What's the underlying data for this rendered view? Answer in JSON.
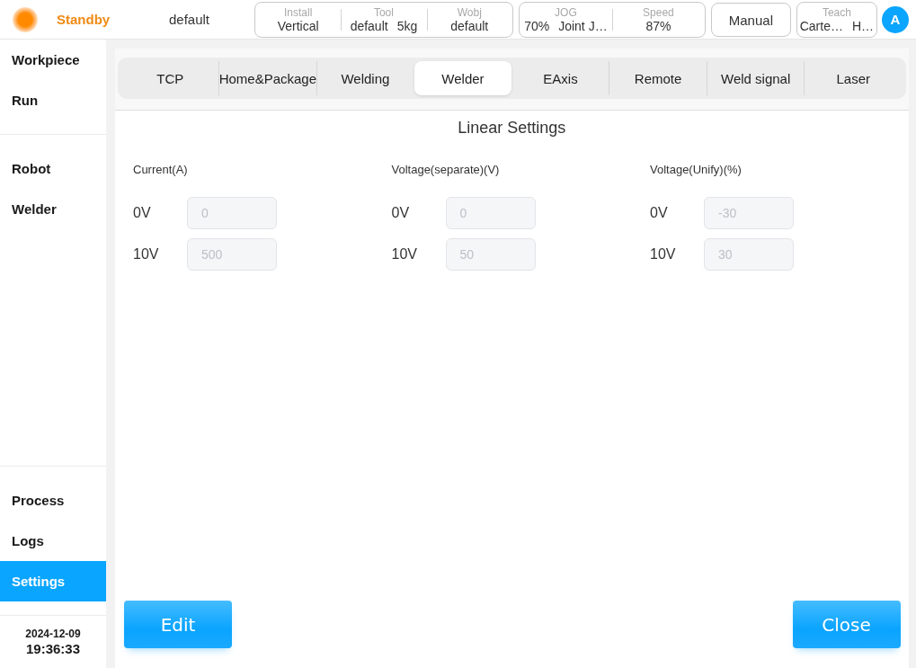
{
  "header": {
    "status": "Standby",
    "profile": "default",
    "widgets": [
      {
        "kind": "group",
        "cells": [
          {
            "label": "Install",
            "values": [
              "Vertical"
            ]
          },
          {
            "label": "Tool",
            "values": [
              "default",
              "5kg"
            ]
          },
          {
            "label": "Wobj",
            "values": [
              "default"
            ]
          }
        ]
      },
      {
        "kind": "group",
        "cells": [
          {
            "label": "JOG",
            "values": [
              "70%",
              "Joint J…"
            ]
          },
          {
            "label": "Speed",
            "values": [
              "87%"
            ]
          }
        ]
      },
      {
        "kind": "button",
        "label": "Manual"
      },
      {
        "kind": "group",
        "cells": [
          {
            "label": "Teach",
            "values": [
              "Carte…",
              "H…"
            ]
          }
        ]
      }
    ],
    "avatar": "A"
  },
  "sidebar": {
    "groups": [
      {
        "items": [
          {
            "label": "Workpiece",
            "selected": false
          },
          {
            "label": "Run",
            "selected": false
          }
        ]
      },
      {
        "items": [
          {
            "label": "Robot",
            "selected": false
          },
          {
            "label": "Welder",
            "selected": false
          }
        ]
      }
    ],
    "bottom_items": [
      {
        "label": "Process",
        "selected": false
      },
      {
        "label": "Logs",
        "selected": false
      },
      {
        "label": "Settings",
        "selected": true
      }
    ],
    "date": "2024-12-09",
    "time": "19:36:33"
  },
  "tabs": [
    {
      "label": "TCP",
      "selected": false
    },
    {
      "label": "Home&Package",
      "selected": false
    },
    {
      "label": "Welding",
      "selected": false
    },
    {
      "label": "Welder",
      "selected": true
    },
    {
      "label": "EAxis",
      "selected": false
    },
    {
      "label": "Remote",
      "selected": false
    },
    {
      "label": "Weld signal",
      "selected": false
    },
    {
      "label": "Laser",
      "selected": false
    }
  ],
  "section_title": "Linear Settings",
  "columns": [
    {
      "heading": "Current(A)",
      "rows": [
        {
          "label": "0V",
          "value": "0",
          "disabled": true
        },
        {
          "label": "10V",
          "value": "500",
          "disabled": true
        }
      ]
    },
    {
      "heading": "Voltage(separate)(V)",
      "rows": [
        {
          "label": "0V",
          "value": "0",
          "disabled": true
        },
        {
          "label": "10V",
          "value": "50",
          "disabled": true
        }
      ]
    },
    {
      "heading": "Voltage(Unify)(%)",
      "rows": [
        {
          "label": "0V",
          "value": "-30",
          "disabled": true
        },
        {
          "label": "10V",
          "value": "30",
          "disabled": true
        }
      ]
    }
  ],
  "buttons": [
    "Edit",
    "Close"
  ]
}
